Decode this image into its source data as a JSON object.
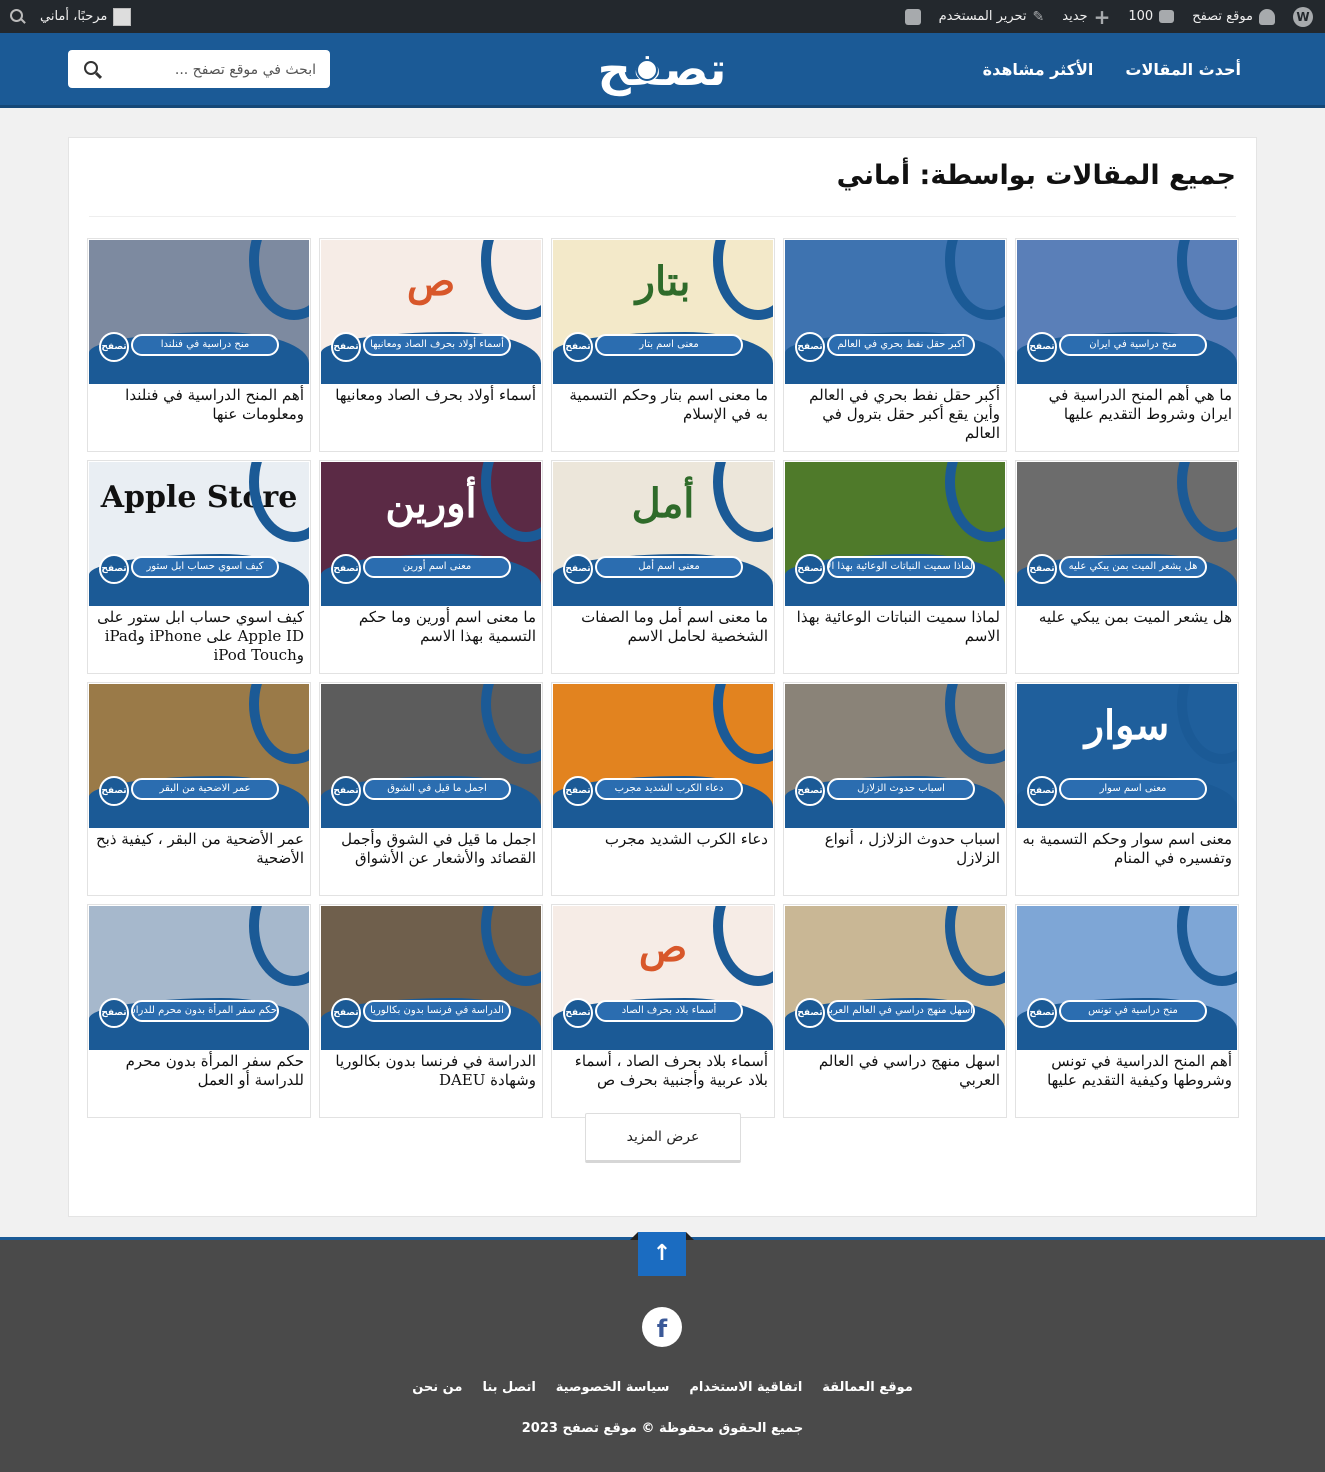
{
  "adminbar": {
    "site_name": "موقع تصفح",
    "comments_count": "100",
    "new_label": "جديد",
    "edit_user_label": "تحرير المستخدم",
    "greeting": "مرحبًا، أماني"
  },
  "header": {
    "logo_text": "تصفح",
    "nav": [
      "أحدث المقالات",
      "الأكثر مشاهدة"
    ],
    "search_placeholder": "ابحث في موقع تصفح ..."
  },
  "page": {
    "title": "جميع المقالات بواسطة: أماني",
    "load_more_label": "عرض المزيد"
  },
  "thumb_brand": "تصفح",
  "articles": [
    {
      "title": "ما هي أهم المنح الدراسية في ايران وشروط التقديم عليها",
      "caption": "منح دراسية في ايران",
      "mark": "",
      "bg": "#5a7fb8"
    },
    {
      "title": "أكبر حقل نفط بحري في العالم وأين يقع أكبر حقل بترول في العالم",
      "caption": "أكبر حقل نفط بحري في العالم",
      "mark": "",
      "bg": "#3e73b0"
    },
    {
      "title": "ما معنى اسم بتار وحكم التسمية به في الإسلام",
      "caption": "معنى اسم بتار",
      "mark": "بتار",
      "bg": "#f3e9c9"
    },
    {
      "title": "أسماء أولاد بحرف الصاد ومعانيها",
      "caption": "أسماء أولاد بحرف الصاد ومعانيها",
      "mark": "ص",
      "bg": "#f6ece6"
    },
    {
      "title": "أهم المنح الدراسية في فنلندا ومعلومات عنها",
      "caption": "منح دراسية في فنلندا",
      "mark": "",
      "bg": "#7d8aa0"
    },
    {
      "title": "هل يشعر الميت بمن يبكي عليه",
      "caption": "هل يشعر الميت بمن يبكي عليه",
      "mark": "",
      "bg": "#6c6c6c"
    },
    {
      "title": "لماذا سميت النباتات الوعائية بهذا الاسم",
      "caption": "لماذا سميت النباتات الوعائية بهذا الاسم",
      "mark": "",
      "bg": "#4f7a2a"
    },
    {
      "title": "ما معنى اسم أمل وما الصفات الشخصية لحامل الاسم",
      "caption": "معنى اسم أمل",
      "mark": "أمل",
      "bg": "#ece6da"
    },
    {
      "title": "ما معنى اسم أورين وما حكم التسمية بهذا الاسم",
      "caption": "معنى اسم أورين",
      "mark": "أورين",
      "bg": "#5b2a45"
    },
    {
      "title": "كيف اسوي حساب ابل ستور على Apple ID على iPhone وiPad وiPod Touch",
      "caption": "كيف اسوي حساب ابل ستور",
      "mark": "Apple Store",
      "bg": "#e9eef3"
    },
    {
      "title": "معنى اسم سوار وحكم التسمية به وتفسيره في المنام",
      "caption": "معنى اسم سوار",
      "mark": "سوار",
      "bg": "#1f5f9c"
    },
    {
      "title": "اسباب حدوث الزلازل ، أنواع الزلازل",
      "caption": "اسباب حدوث الزلازل",
      "mark": "",
      "bg": "#8a8378"
    },
    {
      "title": "دعاء الكرب الشديد مجرب",
      "caption": "دعاء الكرب الشديد مجرب",
      "mark": "",
      "bg": "#e2831f"
    },
    {
      "title": "اجمل ما قيل في الشوق وأجمل القصائد والأشعار عن الأشواق",
      "caption": "اجمل ما قيل في الشوق",
      "mark": "",
      "bg": "#5c5c5c"
    },
    {
      "title": "عمر الأضحية من البقر ، كيفية ذبح الأضحية",
      "caption": "عمر الاضحية من البقر",
      "mark": "",
      "bg": "#9a7a48"
    },
    {
      "title": "أهم المنح الدراسية في تونس وشروطها وكيفية التقديم عليها",
      "caption": "منح دراسية في تونس",
      "mark": "",
      "bg": "#7ea6d6"
    },
    {
      "title": "اسهل منهج دراسي في العالم العربي",
      "caption": "اسهل منهج دراسي في العالم العربي",
      "mark": "",
      "bg": "#c9b795"
    },
    {
      "title": "أسماء بلاد بحرف الصاد ، أسماء بلاد عربية وأجنبية بحرف ص",
      "caption": "أسماء بلاد بحرف الصاد",
      "mark": "ص",
      "bg": "#f6ece6"
    },
    {
      "title": "الدراسة في فرنسا بدون بكالوريا وشهادة DAEU",
      "caption": "الدراسة في فرنسا بدون بكالوريا",
      "mark": "",
      "bg": "#6f5f4c"
    },
    {
      "title": "حكم سفر المرأة بدون محرم للدراسة أو العمل",
      "caption": "حكم سفر المرأة بدون محرم للدراسة",
      "mark": "",
      "bg": "#a6b8cc"
    }
  ],
  "footer": {
    "links": [
      "من نحن",
      "اتصل بنا",
      "سياسة الخصوصية",
      "اتفاقية الاستخدام",
      "موقع العمالقة"
    ],
    "copyright": "جميع الحقوق محفوظة © موقع تصفح 2023"
  }
}
